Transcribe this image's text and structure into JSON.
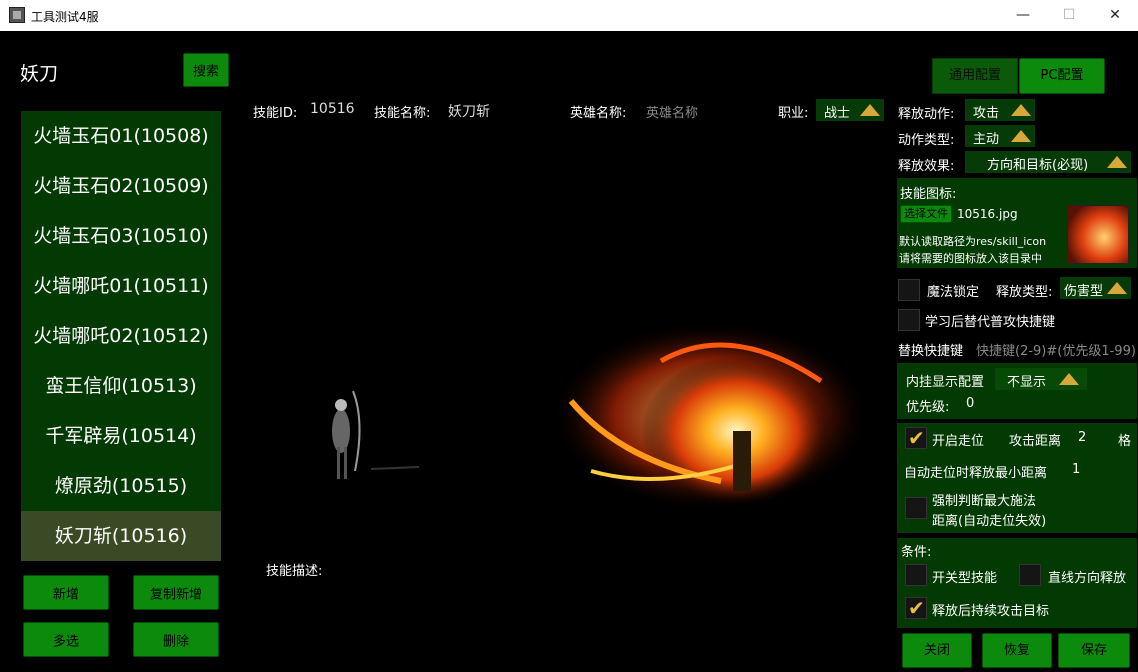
{
  "window": {
    "title": "工具测试4服",
    "minimize": "—",
    "maximize": "☐",
    "close": "✕"
  },
  "header": {
    "title": "妖刀",
    "search_label": "搜索"
  },
  "skill_list": [
    "火墙玉石01(10508)",
    "火墙玉石02(10509)",
    "火墙玉石03(10510)",
    "火墙哪吒01(10511)",
    "火墙哪吒02(10512)",
    "蛮王信仰(10513)",
    "千军辟易(10514)",
    "燎原劲(10515)",
    "妖刀斩(10516)"
  ],
  "selected_index": 8,
  "left_buttons": {
    "add": "新增",
    "copy_add": "复制新增",
    "multi": "多选",
    "delete": "删除"
  },
  "info": {
    "skill_id_label": "技能ID:",
    "skill_id": "10516",
    "skill_name_label": "技能名称:",
    "skill_name": "妖刀斩",
    "hero_name_label": "英雄名称:",
    "hero_name_placeholder": "英雄名称",
    "job_label": "职业:",
    "job": "战士",
    "desc_label": "技能描述:"
  },
  "config_tabs": {
    "general": "通用配置",
    "pc": "PC配置"
  },
  "right": {
    "release_action_label": "释放动作:",
    "release_action": "攻击",
    "action_type_label": "动作类型:",
    "action_type": "主动",
    "release_effect_label": "释放效果:",
    "release_effect": "方向和目标(必现)",
    "icon_label": "技能图标:",
    "choose_file": "选择文件",
    "file_name": "10516.jpg",
    "path_hint1": "默认读取路径为res/skill_icon",
    "path_hint2": "请将需要的图标放入该目录中",
    "magic_lock": "魔法锁定",
    "release_type_label": "释放类型:",
    "release_type": "伤害型",
    "replace_normal": "学习后替代普攻快捷键",
    "replace_hotkey_label": "替换快捷键",
    "replace_hotkey_placeholder": "快捷键(2-9)#(优先级1-99)",
    "inner_display_label": "内挂显示配置",
    "inner_display": "不显示",
    "priority_label": "优先级:",
    "priority": "0",
    "walk_label": "开启走位",
    "attack_dist_label": "攻击距离",
    "attack_dist": "2",
    "attack_dist_unit": "格",
    "auto_walk_min_label": "自动走位时释放最小距离",
    "auto_walk_min": "1",
    "force_max_1": "强制判断最大施法",
    "force_max_2": "距离(自动走位失效)",
    "conditions_label": "条件:",
    "switch_skill": "开关型技能",
    "line_release": "直线方向释放",
    "continue_attack": "释放后持续攻击目标"
  },
  "bottom_buttons": {
    "close": "关闭",
    "restore": "恢复",
    "save": "保存"
  },
  "checks": {
    "magic_lock": false,
    "replace_normal": false,
    "walk": true,
    "force_max": false,
    "switch_skill": false,
    "line_release": false,
    "continue_attack": true
  }
}
